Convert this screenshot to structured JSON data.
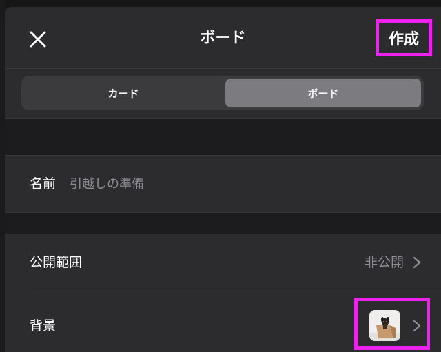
{
  "header": {
    "title": "ボード",
    "create_label": "作成",
    "close_icon": "close-icon"
  },
  "segmented": {
    "card_label": "カード",
    "board_label": "ボード",
    "selected": "ボード"
  },
  "form": {
    "name_label": "名前",
    "name_placeholder": "引越しの準備",
    "visibility_label": "公開範囲",
    "visibility_value": "非公開",
    "background_label": "背景",
    "background_thumbnail_icon": "dog-in-box-photo"
  },
  "colors": {
    "highlight": "#ee22ee",
    "sheet_background": "#2c2c2e",
    "selected_segment": "#7c7c80",
    "secondary_text": "#8e8e93"
  }
}
